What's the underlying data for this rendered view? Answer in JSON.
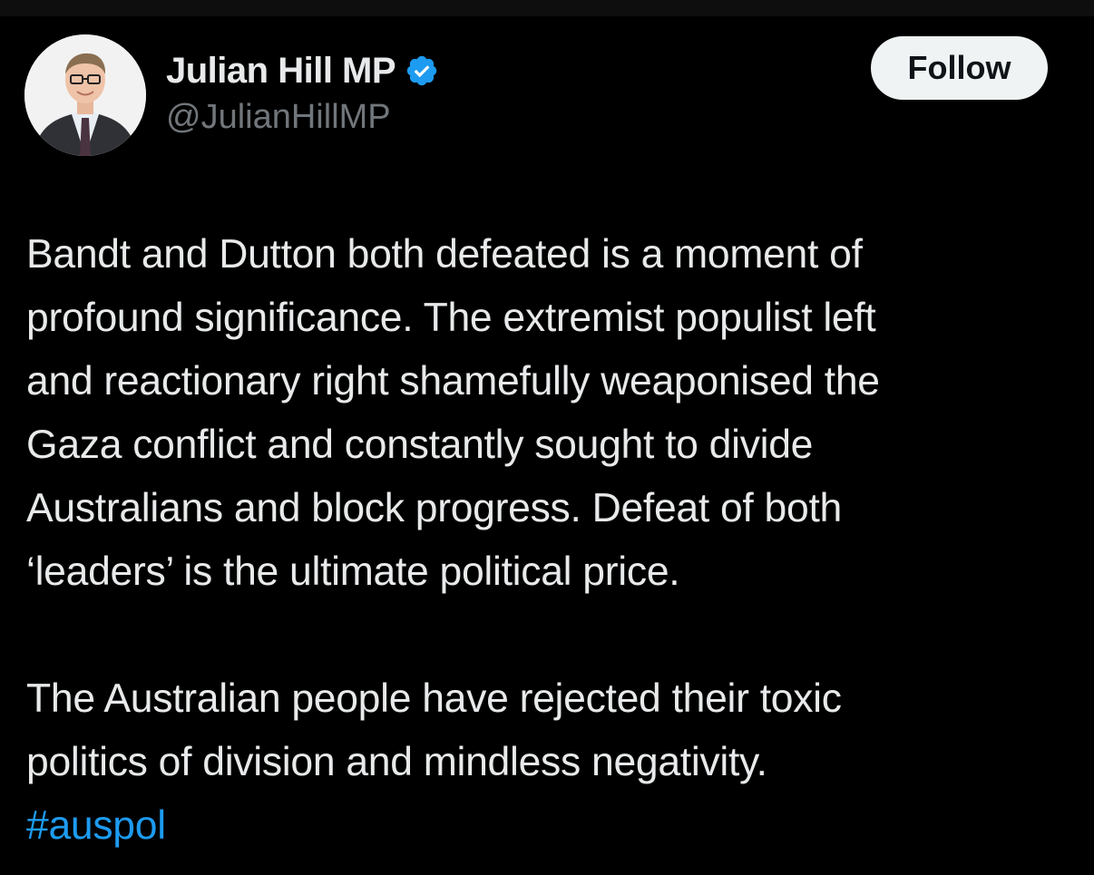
{
  "author": {
    "display_name": "Julian Hill MP",
    "handle": "@JulianHillMP",
    "verified": true,
    "avatar_icon": "profile-photo"
  },
  "actions": {
    "follow_label": "Follow"
  },
  "tweet": {
    "paragraph_1": "Bandt and Dutton both defeated is a moment of\nprofound significance. The extremist populist left\nand reactionary right shamefully weaponised the\nGaza conflict and constantly sought to divide\nAustralians and block progress. Defeat of both\n‘leaders’ is the ultimate political price.",
    "paragraph_2": "The Australian people have rejected their toxic\npolitics of division and mindless negativity.",
    "hashtag": "#auspol"
  },
  "colors": {
    "background": "#000000",
    "text": "#e7e9ea",
    "secondary_text": "#71767b",
    "link": "#1d9bf0",
    "verified_badge": "#1d9bf0",
    "follow_button_bg": "#eff3f4"
  }
}
